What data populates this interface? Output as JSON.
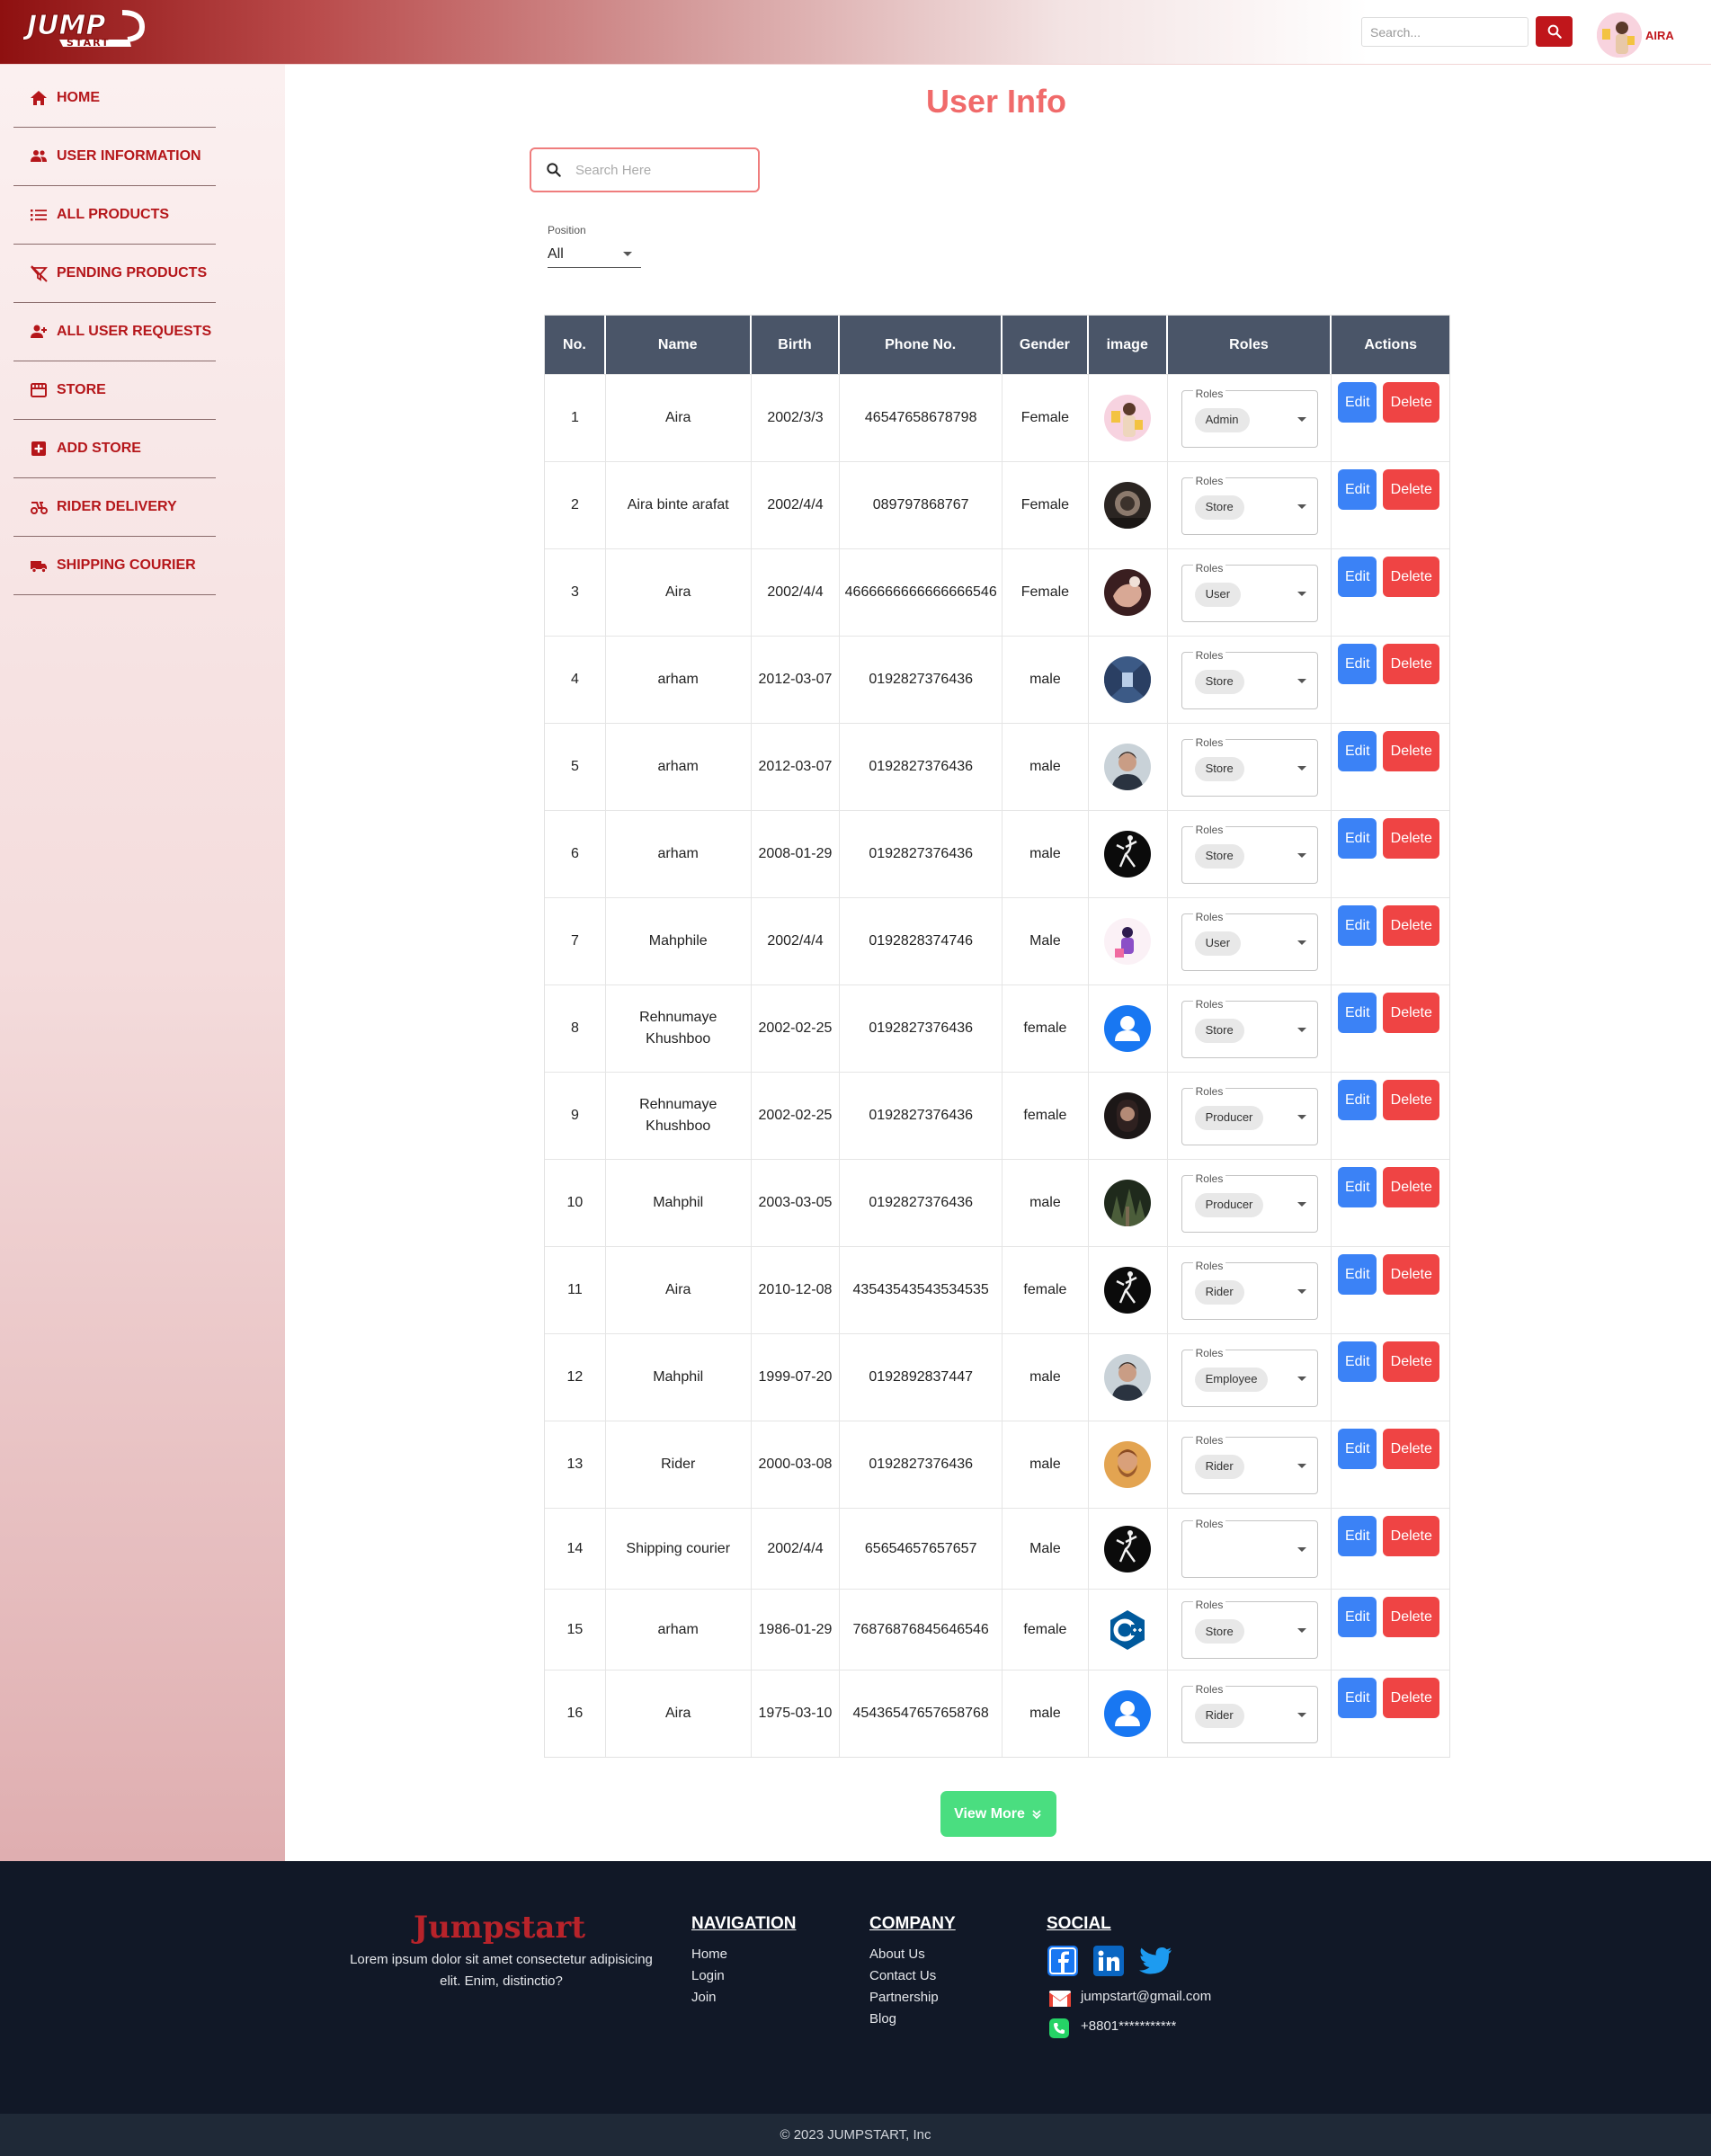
{
  "header": {
    "brand_main": "JUMP",
    "brand_sub": "START",
    "search_placeholder": "Search...",
    "user_name": "AIRA"
  },
  "sidebar": {
    "items": [
      {
        "label": "HOME",
        "icon": "home-icon"
      },
      {
        "label": "USER INFORMATION",
        "icon": "users-icon"
      },
      {
        "label": "ALL PRODUCTS",
        "icon": "list-icon"
      },
      {
        "label": "PENDING PRODUCTS",
        "icon": "filter-off-icon"
      },
      {
        "label": "ALL USER REQUESTS",
        "icon": "user-add-icon"
      },
      {
        "label": "STORE",
        "icon": "store-icon"
      },
      {
        "label": "ADD STORE",
        "icon": "add-box-icon"
      },
      {
        "label": "RIDER DELIVERY",
        "icon": "moped-icon"
      },
      {
        "label": "SHIPPING COURIER",
        "icon": "truck-icon"
      }
    ]
  },
  "main": {
    "title": "User Info",
    "search_placeholder": "Search Here",
    "position_label": "Position",
    "position_value": "All",
    "view_more_label": "View More"
  },
  "table": {
    "columns": [
      "No.",
      "Name",
      "Birth",
      "Phone No.",
      "Gender",
      "image",
      "Roles",
      "Actions"
    ],
    "roles_legend": "Roles",
    "edit_label": "Edit",
    "delete_label": "Delete",
    "rows": [
      {
        "no": "1",
        "name": "Aira",
        "birth": "2002/3/3",
        "phone": "46547658678798",
        "gender": "Female",
        "role": "Admin",
        "avatar": "pink-shopping"
      },
      {
        "no": "2",
        "name": "Aira binte arafat",
        "birth": "2002/4/4",
        "phone": "089797868767",
        "gender": "Female",
        "role": "Store",
        "avatar": "dark-portrait"
      },
      {
        "no": "3",
        "name": "Aira",
        "birth": "2002/4/4",
        "phone": "4666666666666666546",
        "gender": "Female",
        "role": "User",
        "avatar": "hand-photo"
      },
      {
        "no": "4",
        "name": "arham",
        "birth": "2012-03-07",
        "phone": "0192827376436",
        "gender": "male",
        "role": "Store",
        "avatar": "corridor"
      },
      {
        "no": "5",
        "name": "arham",
        "birth": "2012-03-07",
        "phone": "0192827376436",
        "gender": "male",
        "role": "Store",
        "avatar": "man-portrait"
      },
      {
        "no": "6",
        "name": "arham",
        "birth": "2008-01-29",
        "phone": "0192827376436",
        "gender": "male",
        "role": "Store",
        "avatar": "dancer-dark"
      },
      {
        "no": "7",
        "name": "Mahphile",
        "birth": "2002/4/4",
        "phone": "0192828374746",
        "gender": "Male",
        "role": "User",
        "avatar": "illustration"
      },
      {
        "no": "8",
        "name": "Rehnumaye Khushboo",
        "birth": "2002-02-25",
        "phone": "0192827376436",
        "gender": "female",
        "role": "Store",
        "avatar": "default-user"
      },
      {
        "no": "9",
        "name": "Rehnumaye Khushboo",
        "birth": "2002-02-25",
        "phone": "0192827376436",
        "gender": "female",
        "role": "Producer",
        "avatar": "woman-portrait"
      },
      {
        "no": "10",
        "name": "Mahphil",
        "birth": "2003-03-05",
        "phone": "0192827376436",
        "gender": "male",
        "role": "Producer",
        "avatar": "forest"
      },
      {
        "no": "11",
        "name": "Aira",
        "birth": "2010-12-08",
        "phone": "43543543543534535",
        "gender": "female",
        "role": "Rider",
        "avatar": "dancer-dark"
      },
      {
        "no": "12",
        "name": "Mahphil",
        "birth": "1999-07-20",
        "phone": "0192892837447",
        "gender": "male",
        "role": "Employee",
        "avatar": "man-portrait"
      },
      {
        "no": "13",
        "name": "Rider",
        "birth": "2000-03-08",
        "phone": "0192827376436",
        "gender": "male",
        "role": "Rider",
        "avatar": "bearded-man"
      },
      {
        "no": "14",
        "name": "Shipping courier",
        "birth": "2002/4/4",
        "phone": "65654657657657",
        "gender": "Male",
        "role": "",
        "avatar": "dancer-dark"
      },
      {
        "no": "15",
        "name": "arham",
        "birth": "1986-01-29",
        "phone": "76876876845646546",
        "gender": "female",
        "role": "Store",
        "avatar": "cpp-logo"
      },
      {
        "no": "16",
        "name": "Aira",
        "birth": "1975-03-10",
        "phone": "45436547657658768",
        "gender": "male",
        "role": "Rider",
        "avatar": "default-user"
      }
    ]
  },
  "footer": {
    "brand": "Jumpstart",
    "text": "Lorem ipsum dolor sit amet consectetur adipisicing elit. Enim, distinctio?",
    "navigation_heading": "NAVIGATION",
    "navigation_links": [
      "Home",
      "Login",
      "Join"
    ],
    "company_heading": "COMPANY",
    "company_links": [
      "About Us",
      "Contact Us",
      "Partnership",
      "Blog"
    ],
    "social_heading": "SOCIAL",
    "email": "jumpstart@gmail.com",
    "phone": "+8801***********",
    "copyright": "© 2023 JUMPSTART, Inc"
  },
  "colors": {
    "accent": "#c0161b",
    "title": "#f06a6a",
    "table_header": "#4a5568",
    "edit": "#3b82f6",
    "delete": "#ef4444",
    "view_more": "#4ade80",
    "footer_bg": "#111827"
  }
}
